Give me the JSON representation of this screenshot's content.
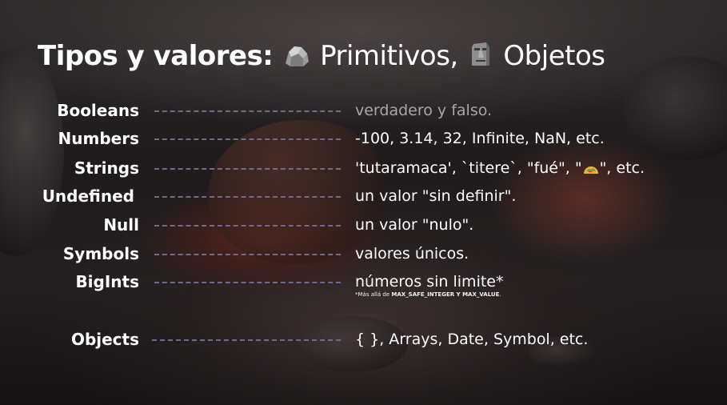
{
  "slide": {
    "title_bold": "Tipos y valores:",
    "title_part1": "Primitivos,",
    "title_part2": "Objetos",
    "icon_primitives": "rock-icon",
    "icon_objects": "moai-icon"
  },
  "types": [
    {
      "label": "Booleans",
      "value": "verdadero y falso."
    },
    {
      "label": "Numbers",
      "value": "-100, 3.14, 32, Infinite, NaN, etc."
    },
    {
      "label": "Strings",
      "value_prefix": "'tutaramaca', `titere`, \"fué\", \"",
      "value_icon": "taco-icon",
      "value_suffix": "\", etc."
    },
    {
      "label": "Undefined",
      "value": "un valor \"sin definir\"."
    },
    {
      "label": "Null",
      "value": "un valor \"nulo\"."
    },
    {
      "label": "Symbols",
      "value": "valores únicos."
    },
    {
      "label": "BigInts",
      "value": "números sin limite*"
    }
  ],
  "footnote": {
    "prefix": "*Más allá de ",
    "term1": "MAX_SAFE_INTEGER",
    "conj": " Y ",
    "term2": "MAX_VALUE",
    "end": "."
  },
  "objects": {
    "label": "Objects",
    "value": "{ }, Arrays, Date, Symbol, etc."
  },
  "colors": {
    "text": "#ffffff",
    "muted_text": "#a9a6a6",
    "dash": "#6e6a8a"
  }
}
